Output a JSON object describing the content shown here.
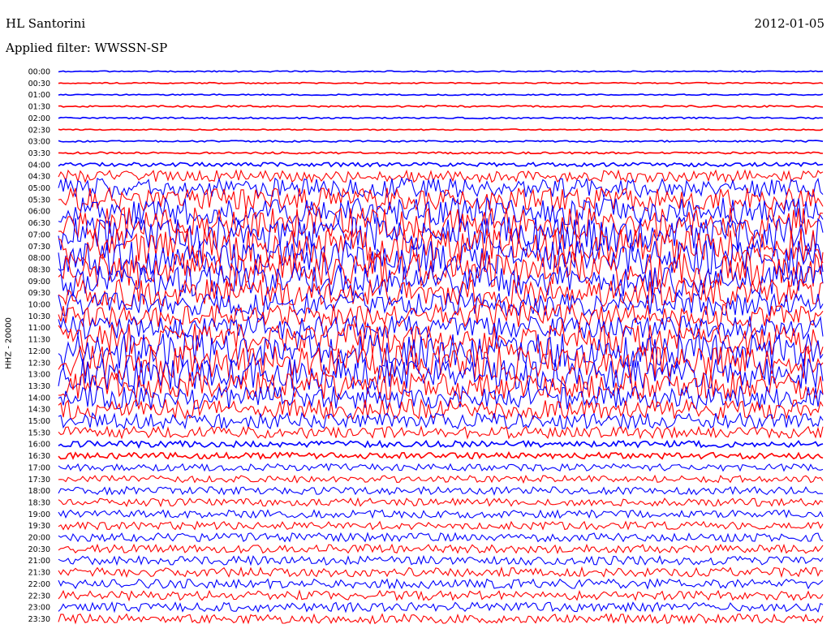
{
  "header": {
    "station": "HL Santorini",
    "date": "2012-01-05",
    "filter": "Applied filter: WWSSN-SP"
  },
  "chart_data": {
    "type": "line",
    "title": "HL Santorini",
    "ylabel": "HHZ - 20000",
    "colors": [
      "#0000ff",
      "#ff0000"
    ],
    "rows": [
      "00:00",
      "00:30",
      "01:00",
      "01:30",
      "02:00",
      "02:30",
      "03:00",
      "03:30",
      "04:00",
      "04:30",
      "05:00",
      "05:30",
      "06:00",
      "06:30",
      "07:00",
      "07:30",
      "08:00",
      "08:30",
      "09:00",
      "09:30",
      "10:00",
      "10:30",
      "11:00",
      "11:30",
      "12:00",
      "12:30",
      "13:00",
      "13:30",
      "14:00",
      "14:30",
      "15:00",
      "15:30",
      "16:00",
      "16:30",
      "17:00",
      "17:30",
      "18:00",
      "18:30",
      "19:00",
      "19:30",
      "20:00",
      "20:30",
      "21:00",
      "21:30",
      "22:00",
      "22:30",
      "23:00",
      "23:30"
    ],
    "amplitude_relative": [
      0.3,
      0.3,
      0.3,
      0.4,
      0.4,
      0.3,
      0.4,
      0.5,
      1.0,
      3.0,
      5.0,
      6.0,
      7.0,
      8.0,
      9.0,
      9.0,
      9.0,
      9.0,
      8.0,
      7.0,
      6.0,
      6.0,
      6.0,
      8.0,
      9.0,
      9.0,
      8.0,
      7.0,
      6.0,
      5.0,
      4.0,
      3.0,
      1.6,
      1.6,
      1.8,
      1.8,
      2.0,
      2.0,
      2.0,
      2.0,
      2.2,
      2.2,
      2.2,
      2.3,
      2.4,
      2.4,
      2.4,
      2.4
    ],
    "grid": false
  }
}
